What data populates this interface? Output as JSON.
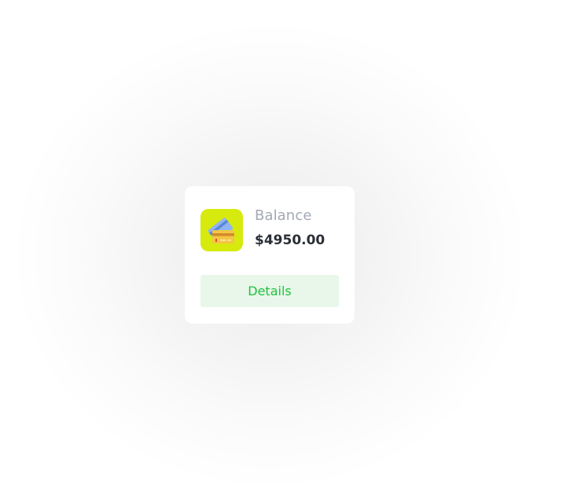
{
  "card": {
    "icon": "credit-card-icon",
    "label": "Balance",
    "amount": "$4950.00",
    "button_label": "Details"
  },
  "colors": {
    "icon_background": "#d6ea0e",
    "button_background": "#e8f7ea",
    "button_text": "#22c03f",
    "label_text": "#a3a9b4",
    "amount_text": "#2b2f36"
  }
}
